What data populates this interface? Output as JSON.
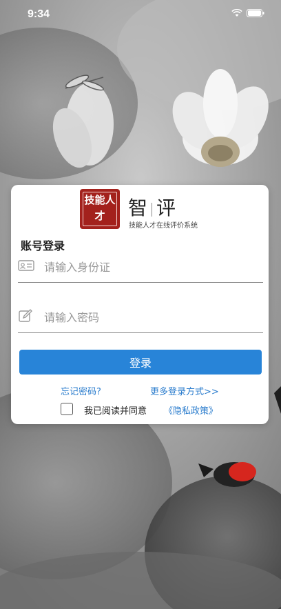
{
  "status_bar": {
    "time": "9:34"
  },
  "logo": {
    "seal_text": "技能人才",
    "brand_left": "智",
    "brand_right": "评",
    "tagline": "技能人才在线评价系统"
  },
  "login": {
    "title": "账号登录",
    "id_placeholder": "请输入身份证",
    "password_placeholder": "请输入密码",
    "button_label": "登录",
    "forgot_password": "忘记密码?",
    "more_methods": "更多登录方式>>",
    "agree_text": "我已阅读并同意",
    "privacy_policy": "《隐私政策》",
    "agreed": false
  },
  "colors": {
    "accent": "#2884d8",
    "seal": "#a3211c",
    "link": "#2a7ccd"
  }
}
